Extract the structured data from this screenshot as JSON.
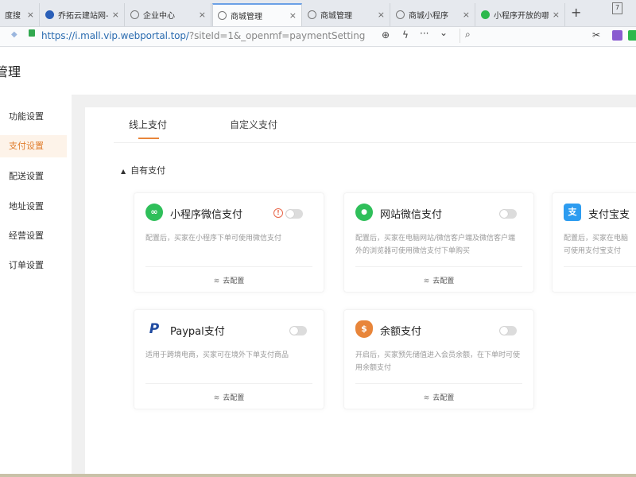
{
  "browser": {
    "tabs": [
      {
        "title": "度搜",
        "icon_color": "#3a7bd5",
        "active": false
      },
      {
        "title": "乔拓云建站网-小",
        "icon_color": "#2a5fb8",
        "active": false
      },
      {
        "title": "企业中心",
        "icon_color": "#8a8a8a",
        "active": false
      },
      {
        "title": "商城管理",
        "icon_color": "#8a8a8a",
        "active": true
      },
      {
        "title": "商城管理",
        "icon_color": "#8a8a8a",
        "active": false
      },
      {
        "title": "商城小程序",
        "icon_color": "#8a8a8a",
        "active": false
      },
      {
        "title": "小程序开放的哪",
        "icon_color": "#2db84d",
        "active": false
      }
    ],
    "close_glyph": "×",
    "new_tab_glyph": "+",
    "menu_glyph": "7",
    "url_main": "https://i.mall.vip.webportal.top/",
    "url_rest": "?siteId=1&_openmf=paymentSetting",
    "toolbar_glyphs": {
      "zoom": "⊕",
      "flash": "ϟ",
      "more": "···",
      "dropdown": "⌄",
      "search": "⌕",
      "scissors": "✂"
    }
  },
  "page": {
    "title": "管理"
  },
  "sidebar": {
    "items": [
      {
        "label": "功能设置",
        "active": false
      },
      {
        "label": "支付设置",
        "active": true
      },
      {
        "label": "配送设置",
        "active": false
      },
      {
        "label": "地址设置",
        "active": false
      },
      {
        "label": "经营设置",
        "active": false
      },
      {
        "label": "订单设置",
        "active": false
      }
    ]
  },
  "main": {
    "tabs": [
      {
        "label": "线上支付",
        "active": true
      },
      {
        "label": "自定义支付",
        "active": false
      }
    ],
    "section_arrow": "▲",
    "section_title": "自有支付",
    "config_icon": "≋",
    "payments": [
      {
        "name": "小程序微信支付",
        "icon": "mini-program-pay",
        "icon_glyph": "∞",
        "icon_color": "#2fbf5a",
        "enabled": false,
        "warning": true,
        "description": "配置后，买家在小程序下单可使用微信支付",
        "config_label": "去配置"
      },
      {
        "name": "网站微信支付",
        "icon": "wechat-pay",
        "icon_glyph": "●",
        "icon_color": "#2fbf5a",
        "enabled": false,
        "warning": false,
        "description": "配置后，买家在电脑网站/微信客户端及微信客户端外的浏览器可使用微信支付下单购买",
        "config_label": "去配置"
      },
      {
        "name": "支付宝支",
        "icon": "alipay",
        "icon_glyph": "支",
        "icon_color": "#2d9cf0",
        "enabled": false,
        "warning": false,
        "description": "配置后，买家在电脑可使用支付宝支付",
        "config_label": ""
      },
      {
        "name": "Paypal支付",
        "icon": "paypal",
        "icon_glyph": "P",
        "icon_color": "#1f4aa0",
        "enabled": false,
        "warning": false,
        "description": "适用于跨境电商，买家可在境外下单支付商品",
        "config_label": "去配置"
      },
      {
        "name": "余额支付",
        "icon": "balance-pay",
        "icon_glyph": "$",
        "icon_color": "#e8853a",
        "enabled": false,
        "warning": false,
        "description": "开启后，买家预先储值进入会员余额，在下单时可使用余额支付",
        "config_label": "去配置"
      }
    ],
    "warning_glyph": "!"
  },
  "colors": {
    "accent": "#e8853a",
    "sidebar_active_bg": "#fdf3e9",
    "toggle_off": "#dcdcdc",
    "link": "#2b6cb0"
  }
}
